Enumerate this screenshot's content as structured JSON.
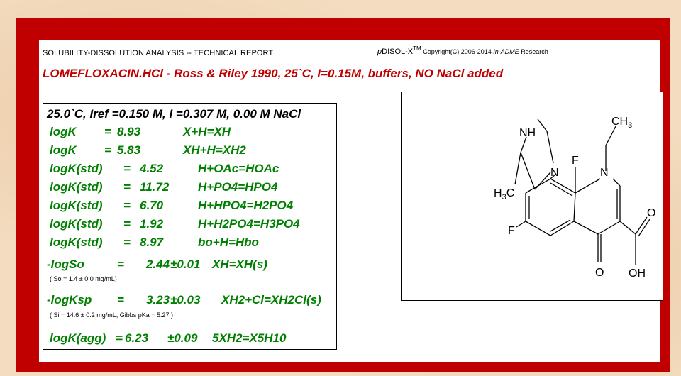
{
  "report": {
    "header_left": "SOLUBILITY-DISSOLUTION ANALYSIS -- TECHNICAL REPORT",
    "header_right_p": "p",
    "header_right_brand": "DISOL-X",
    "header_right_tm": "TM",
    "header_right_copy": " Copyright(C) 2006-2014 ",
    "header_right_company": "In-ADME",
    "header_right_tail": " Research",
    "title": "LOMEFLOXACIN.HCl - Ross & Riley 1990, 25`C, I=0.15M, buffers, NO NaCl added"
  },
  "conditions": "25.0`C, Iref =0.150 M, I =0.307 M, 0.00 M NaCl",
  "constants": [
    {
      "label": "logK",
      "eq": "=",
      "value": "8.93",
      "reaction": "X+H=XH"
    },
    {
      "label": "logK",
      "eq": "=",
      "value": "5.83",
      "reaction": "XH+H=XH2"
    },
    {
      "label": "logK(std)",
      "eq": "=",
      "value": "4.52",
      "reaction": "H+OAc=HOAc"
    },
    {
      "label": "logK(std)",
      "eq": "=",
      "value": "11.72",
      "reaction": "H+PO4=HPO4"
    },
    {
      "label": "logK(std)",
      "eq": "=",
      "value": "6.70",
      "reaction": "H+HPO4=H2PO4"
    },
    {
      "label": "logK(std)",
      "eq": "=",
      "value": "1.92",
      "reaction": "H+H2PO4=H3PO4"
    },
    {
      "label": "logK(std)",
      "eq": "=",
      "value": "8.97",
      "reaction": "bo+H=Hbo"
    }
  ],
  "logSo": {
    "label": "-logSo",
    "eq": "=",
    "value": "2.44",
    "err": "±0.01",
    "reaction": "XH=XH(s)",
    "note": "( So = 1.4 ± 0.0 mg/mL)"
  },
  "logKsp": {
    "label": "-logKsp",
    "eq": "=",
    "value": "3.23",
    "err": "±0.03",
    "reaction": "XH2+Cl=XH2Cl(s)",
    "note": "( Si = 14.6 ± 0.2 mg/mL, Gibbs pKa = 5.27 )"
  },
  "logKagg": {
    "label": "logK(agg)",
    "eq": "=",
    "value": "6.23",
    "err": "±0.09",
    "reaction": "5XH2=X5H10"
  },
  "structure_atoms": {
    "ch3": "CH",
    "ch3_sub": "3",
    "nh": "NH",
    "f_top": "F",
    "n_ring": "N",
    "n_pip": "N",
    "h3c": "H",
    "h3c_sub": "3",
    "h3c_c": "C",
    "f_left": "F",
    "o_bottom": "O",
    "oh": "OH",
    "o_acid": "O"
  },
  "colors": {
    "frame": "#c00000",
    "data_text": "#008000",
    "title": "#c00000"
  }
}
